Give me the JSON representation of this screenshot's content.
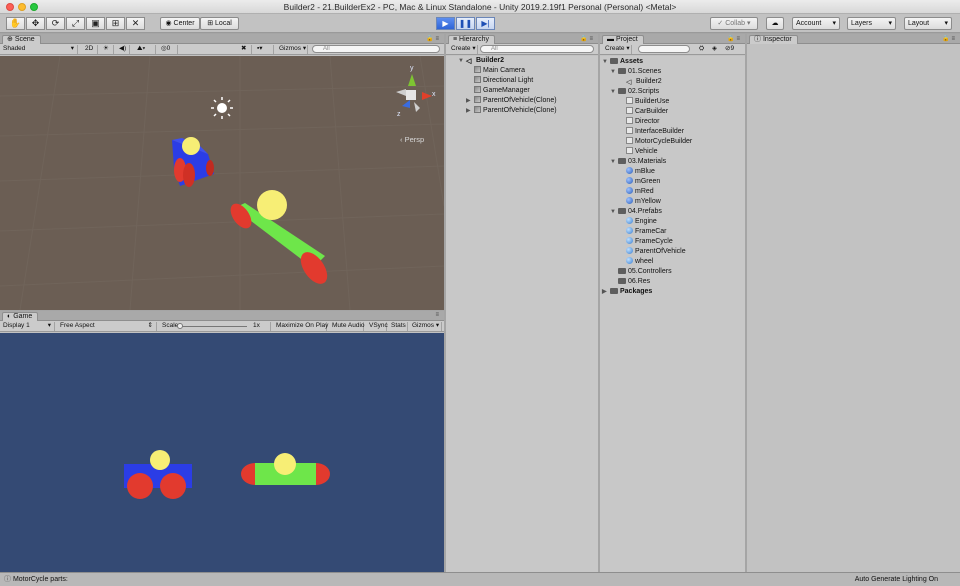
{
  "window": {
    "title": "Builder2 - 21.BuilderEx2 - PC, Mac & Linux Standalone - Unity 2019.2.19f1 Personal (Personal) <Metal>"
  },
  "toolbar": {
    "tools": [
      "hand-tool",
      "move-tool",
      "rotate-tool",
      "scale-tool",
      "rect-tool",
      "transform-tool",
      "custom-tool"
    ],
    "pivot_label": "Center",
    "space_label": "Local",
    "collab_label": "Collab",
    "account_label": "Account",
    "layers_label": "Layers",
    "layout_label": "Layout",
    "play_active": true
  },
  "scene": {
    "tab_label": "Scene",
    "shading_label": "Shaded",
    "mode_2d_label": "2D",
    "fx_count": "0",
    "gizmos_label": "Gizmos",
    "search_placeholder": "All",
    "persp_label": "Persp",
    "gizmo_axes": {
      "y": "y",
      "x": "x",
      "z": "z"
    },
    "colors": {
      "background": "#6b5e54",
      "blue": "#2b3de6",
      "red": "#e23a2e",
      "green": "#6ee64a",
      "yellow": "#f7ee75"
    }
  },
  "game": {
    "tab_label": "Game",
    "display_label": "Display 1",
    "aspect_label": "Free Aspect",
    "scale_label": "Scale",
    "scale_value": "1x",
    "maximize_label": "Maximize On Play",
    "mute_label": "Mute Audio",
    "vsync_label": "VSync",
    "stats_label": "Stats",
    "gizmos_label": "Gizmos",
    "colors": {
      "background": "#344a74"
    }
  },
  "hierarchy": {
    "tab_label": "Hierarchy",
    "create_label": "Create",
    "search_placeholder": "All",
    "scene_name": "Builder2",
    "items": [
      {
        "label": "Main Camera",
        "expandable": false
      },
      {
        "label": "Directional Light",
        "expandable": false
      },
      {
        "label": "GameManager",
        "expandable": false
      },
      {
        "label": "ParentOfVehicle(Clone)",
        "expandable": true
      },
      {
        "label": "ParentOfVehicle(Clone)",
        "expandable": true
      }
    ]
  },
  "project": {
    "tab_label": "Project",
    "create_label": "Create",
    "hidden_count": "9",
    "root_label": "Assets",
    "packages_label": "Packages",
    "rows": [
      {
        "label": "01.Scenes",
        "kind": "folder",
        "depth": 1,
        "expanded": true
      },
      {
        "label": "Builder2",
        "kind": "unity",
        "depth": 2
      },
      {
        "label": "02.Scripts",
        "kind": "folder",
        "depth": 1,
        "expanded": true
      },
      {
        "label": "BuilderUse",
        "kind": "script",
        "depth": 2
      },
      {
        "label": "CarBuilder",
        "kind": "script",
        "depth": 2
      },
      {
        "label": "Director",
        "kind": "script",
        "depth": 2
      },
      {
        "label": "InterfaceBuilder",
        "kind": "script",
        "depth": 2
      },
      {
        "label": "MotorCycleBuilder",
        "kind": "script",
        "depth": 2
      },
      {
        "label": "Vehicle",
        "kind": "script",
        "depth": 2
      },
      {
        "label": "03.Materials",
        "kind": "folder",
        "depth": 1,
        "expanded": true
      },
      {
        "label": "mBlue",
        "kind": "material",
        "depth": 2
      },
      {
        "label": "mGreen",
        "kind": "material",
        "depth": 2
      },
      {
        "label": "mRed",
        "kind": "material",
        "depth": 2
      },
      {
        "label": "mYellow",
        "kind": "material",
        "depth": 2
      },
      {
        "label": "04.Prefabs",
        "kind": "folder",
        "depth": 1,
        "expanded": true
      },
      {
        "label": "Engine",
        "kind": "prefab",
        "depth": 2
      },
      {
        "label": "FrameCar",
        "kind": "prefab",
        "depth": 2
      },
      {
        "label": "FrameCycle",
        "kind": "prefab",
        "depth": 2
      },
      {
        "label": "ParentOfVehicle",
        "kind": "prefab",
        "depth": 2
      },
      {
        "label": "wheel",
        "kind": "prefab",
        "depth": 2
      },
      {
        "label": "05.Controllers",
        "kind": "folder",
        "depth": 1,
        "expanded": false
      },
      {
        "label": "06.Res",
        "kind": "folder",
        "depth": 1,
        "expanded": false
      }
    ]
  },
  "inspector": {
    "tab_label": "Inspector"
  },
  "status": {
    "console_message": "MotorCycle parts:",
    "lighting_label": "Auto Generate Lighting On"
  }
}
